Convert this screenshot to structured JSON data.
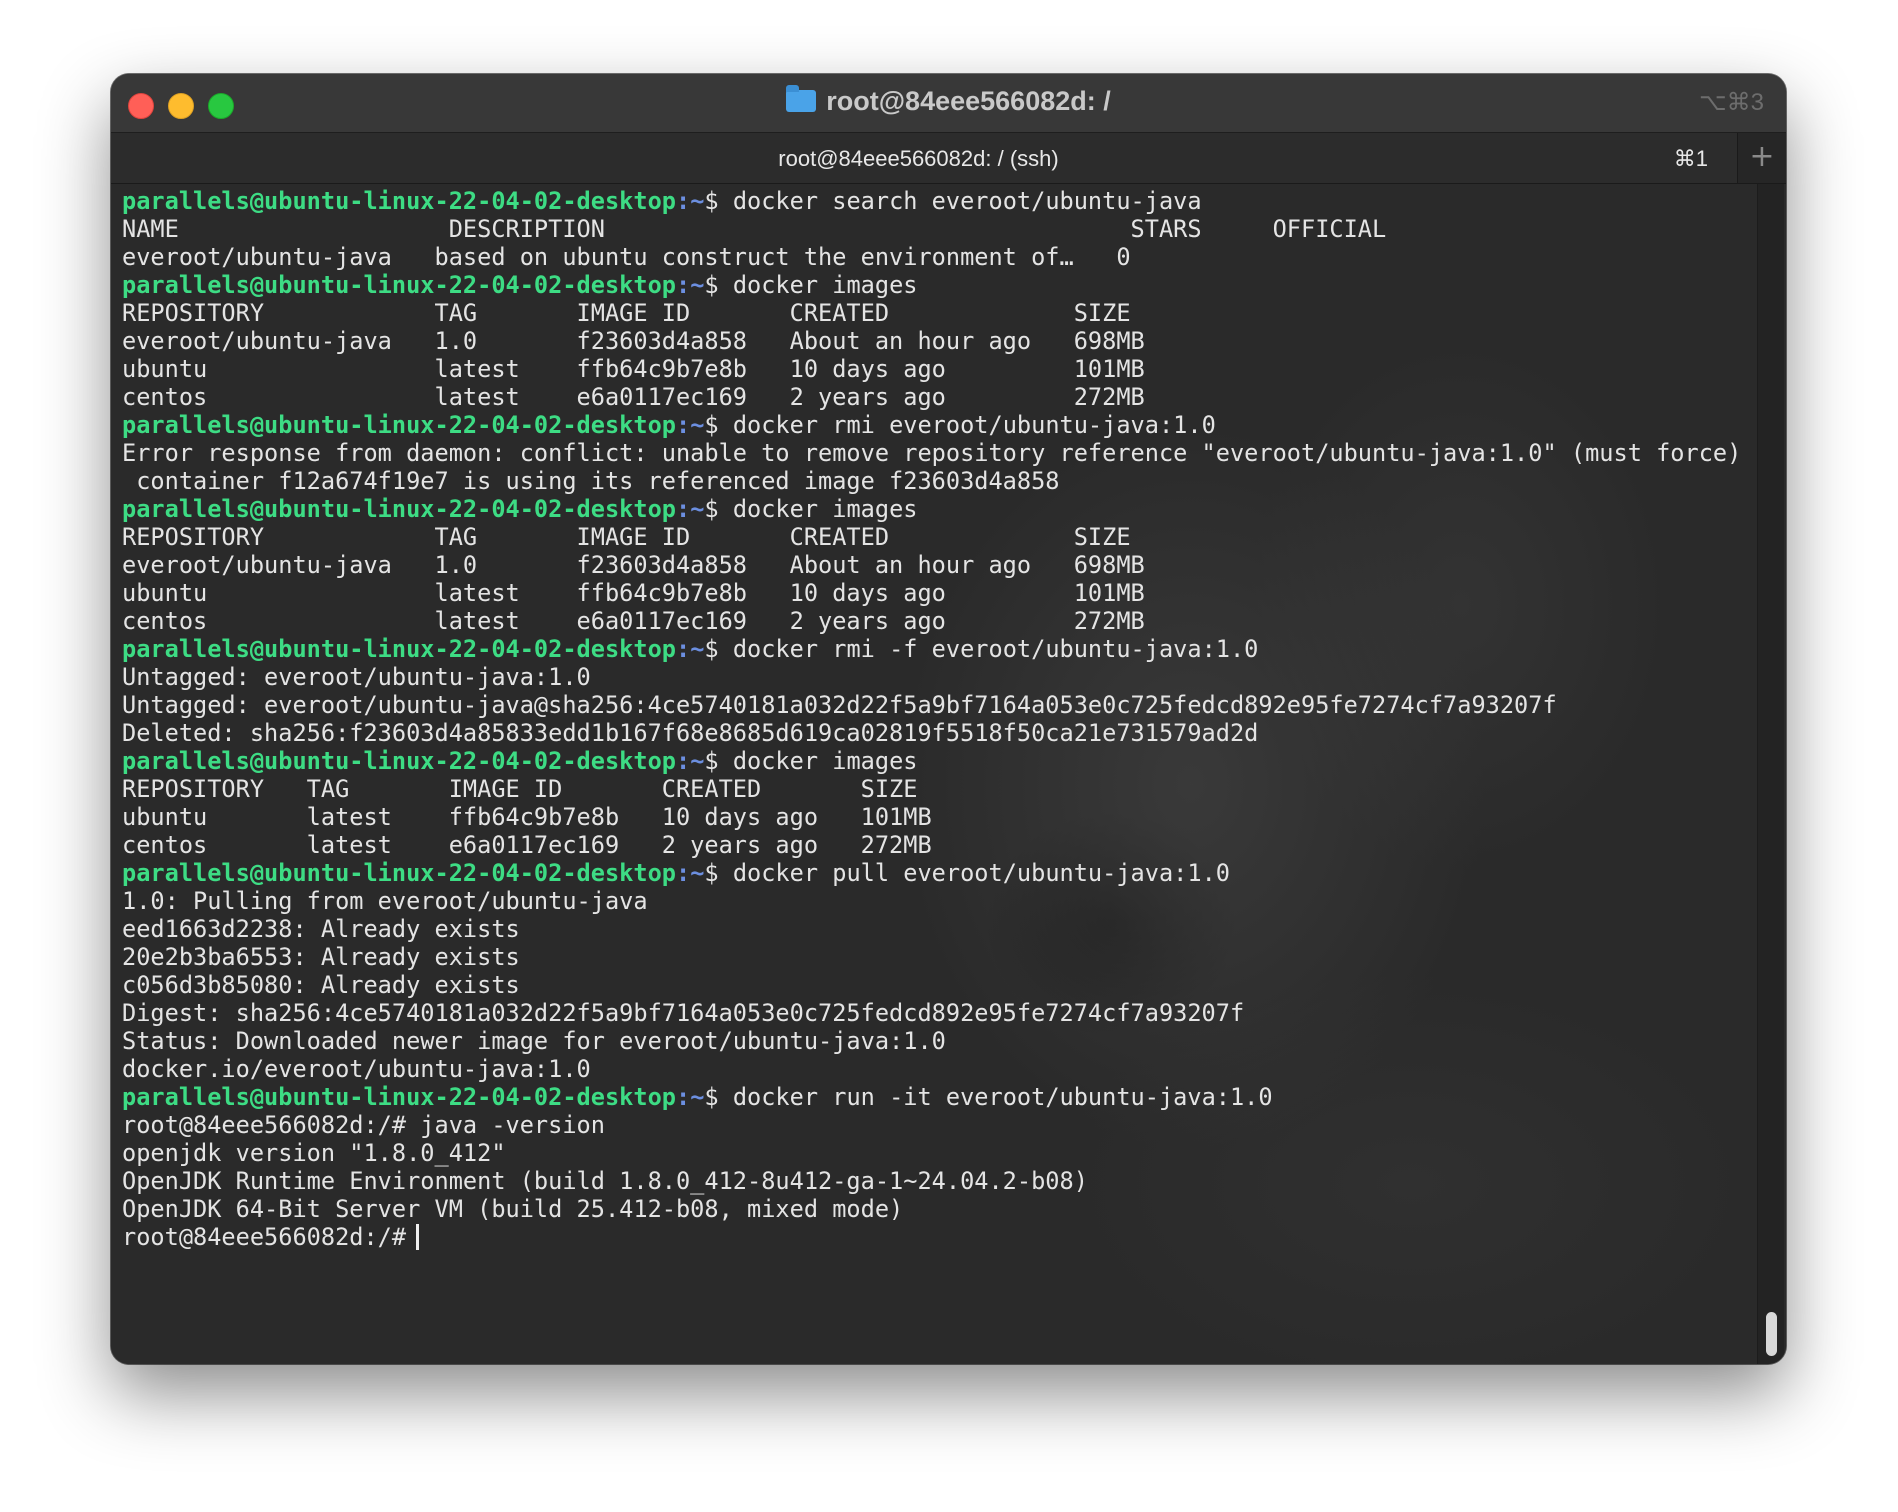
{
  "window": {
    "title": "root@84eee566082d: /",
    "shortcut": "⌥⌘3"
  },
  "tab": {
    "label": "root@84eee566082d: / (ssh)",
    "shortcut": "⌘1",
    "new_tab": "+"
  },
  "terminal": {
    "prompt": "parallels@ubuntu-linux-22-04-02-desktop",
    "path": ":~",
    "lines": [
      {
        "type": "cmd",
        "text": "$ docker search everoot/ubuntu-java"
      },
      {
        "type": "out",
        "text": "NAME                   DESCRIPTION                                     STARS     OFFICIAL"
      },
      {
        "type": "out",
        "text": "everoot/ubuntu-java   based on ubuntu construct the environment of…   0"
      },
      {
        "type": "cmd",
        "text": "$ docker images"
      },
      {
        "type": "out",
        "text": "REPOSITORY            TAG       IMAGE ID       CREATED             SIZE"
      },
      {
        "type": "out",
        "text": "everoot/ubuntu-java   1.0       f23603d4a858   About an hour ago   698MB"
      },
      {
        "type": "out",
        "text": "ubuntu                latest    ffb64c9b7e8b   10 days ago         101MB"
      },
      {
        "type": "out",
        "text": "centos                latest    e6a0117ec169   2 years ago         272MB"
      },
      {
        "type": "cmd",
        "text": "$ docker rmi everoot/ubuntu-java:1.0"
      },
      {
        "type": "out",
        "text": "Error response from daemon: conflict: unable to remove repository reference \"everoot/ubuntu-java:1.0\" (must force) -"
      },
      {
        "type": "out",
        "text": " container f12a674f19e7 is using its referenced image f23603d4a858"
      },
      {
        "type": "cmd",
        "text": "$ docker images"
      },
      {
        "type": "out",
        "text": "REPOSITORY            TAG       IMAGE ID       CREATED             SIZE"
      },
      {
        "type": "out",
        "text": "everoot/ubuntu-java   1.0       f23603d4a858   About an hour ago   698MB"
      },
      {
        "type": "out",
        "text": "ubuntu                latest    ffb64c9b7e8b   10 days ago         101MB"
      },
      {
        "type": "out",
        "text": "centos                latest    e6a0117ec169   2 years ago         272MB"
      },
      {
        "type": "cmd",
        "text": "$ docker rmi -f everoot/ubuntu-java:1.0"
      },
      {
        "type": "out",
        "text": "Untagged: everoot/ubuntu-java:1.0"
      },
      {
        "type": "out",
        "text": "Untagged: everoot/ubuntu-java@sha256:4ce5740181a032d22f5a9bf7164a053e0c725fedcd892e95fe7274cf7a93207f"
      },
      {
        "type": "out",
        "text": "Deleted: sha256:f23603d4a85833edd1b167f68e8685d619ca02819f5518f50ca21e731579ad2d"
      },
      {
        "type": "cmd",
        "text": "$ docker images"
      },
      {
        "type": "out",
        "text": "REPOSITORY   TAG       IMAGE ID       CREATED       SIZE"
      },
      {
        "type": "out",
        "text": "ubuntu       latest    ffb64c9b7e8b   10 days ago   101MB"
      },
      {
        "type": "out",
        "text": "centos       latest    e6a0117ec169   2 years ago   272MB"
      },
      {
        "type": "cmd",
        "text": "$ docker pull everoot/ubuntu-java:1.0"
      },
      {
        "type": "out",
        "text": "1.0: Pulling from everoot/ubuntu-java"
      },
      {
        "type": "out",
        "text": "eed1663d2238: Already exists"
      },
      {
        "type": "out",
        "text": "20e2b3ba6553: Already exists"
      },
      {
        "type": "out",
        "text": "c056d3b85080: Already exists"
      },
      {
        "type": "out",
        "text": "Digest: sha256:4ce5740181a032d22f5a9bf7164a053e0c725fedcd892e95fe7274cf7a93207f"
      },
      {
        "type": "out",
        "text": "Status: Downloaded newer image for everoot/ubuntu-java:1.0"
      },
      {
        "type": "out",
        "text": "docker.io/everoot/ubuntu-java:1.0"
      },
      {
        "type": "cmd",
        "text": "$ docker run -it everoot/ubuntu-java:1.0"
      },
      {
        "type": "out",
        "text": "root@84eee566082d:/# java -version"
      },
      {
        "type": "out",
        "text": "openjdk version \"1.8.0_412\""
      },
      {
        "type": "out",
        "text": "OpenJDK Runtime Environment (build 1.8.0_412-8u412-ga-1~24.04.2-b08)"
      },
      {
        "type": "out",
        "text": "OpenJDK 64-Bit Server VM (build 25.412-b08, mixed mode)"
      },
      {
        "type": "cursor",
        "text": "root@84eee566082d:/#"
      }
    ]
  }
}
